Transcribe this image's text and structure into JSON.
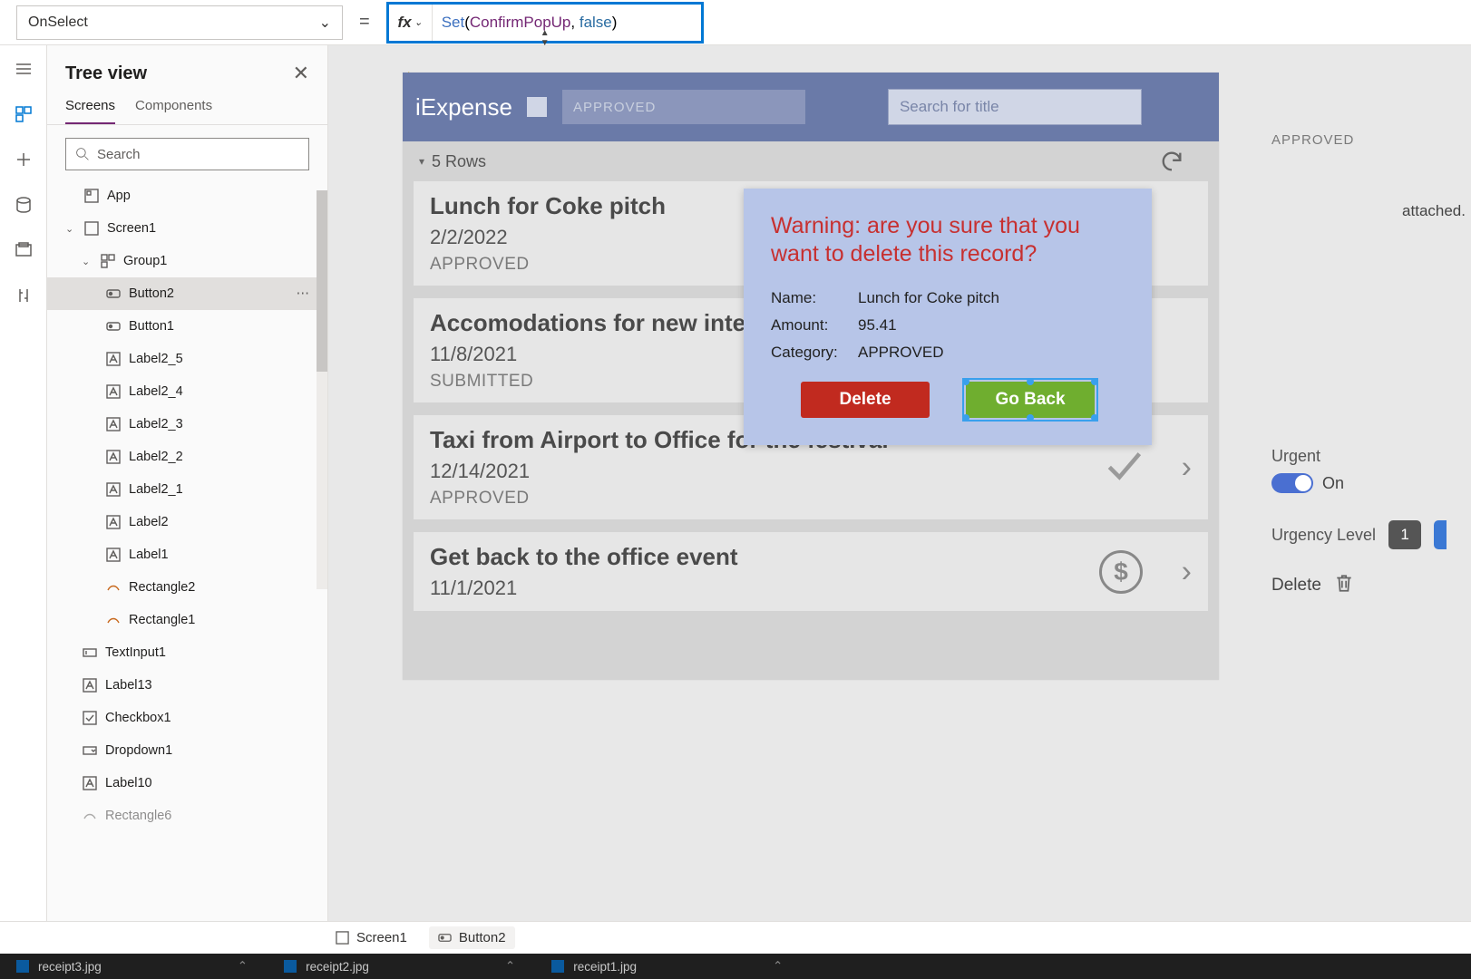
{
  "propertyDropdown": "OnSelect",
  "formula": {
    "fn": "Set",
    "open": "(",
    "arg1": "ConfirmPopUp",
    "comma": ", ",
    "arg2": "false",
    "close": ")"
  },
  "treeView": {
    "title": "Tree view",
    "tabs": {
      "screens": "Screens",
      "components": "Components"
    },
    "searchPlaceholder": "Search",
    "items": {
      "app": "App",
      "screen1": "Screen1",
      "group1": "Group1",
      "button2": "Button2",
      "button1": "Button1",
      "label2_5": "Label2_5",
      "label2_4": "Label2_4",
      "label2_3": "Label2_3",
      "label2_2": "Label2_2",
      "label2_1": "Label2_1",
      "label2": "Label2",
      "label1": "Label1",
      "rectangle2": "Rectangle2",
      "rectangle1": "Rectangle1",
      "textinput1": "TextInput1",
      "label13": "Label13",
      "checkbox1": "Checkbox1",
      "dropdown1": "Dropdown1",
      "label10": "Label10",
      "rectangle6": "Rectangle6"
    }
  },
  "app": {
    "title": "iExpense",
    "filterDropdown": "APPROVED",
    "searchPlaceholder": "Search for title",
    "rowsLabel": "5 Rows",
    "cards": [
      {
        "title": "Lunch for Coke pitch",
        "date": "2/2/2022",
        "status": "APPROVED",
        "icon": "check"
      },
      {
        "title": "Accomodations for new interv",
        "date": "11/8/2021",
        "status": "SUBMITTED",
        "icon": ""
      },
      {
        "title": "Taxi from Airport to Office for the festival",
        "date": "12/14/2021",
        "status": "APPROVED",
        "icon": "check"
      },
      {
        "title": "Get back to the office event",
        "date": "11/1/2021",
        "status": "",
        "icon": "dollar"
      }
    ]
  },
  "popup": {
    "warning": "Warning: are you sure that you want to delete this record?",
    "nameLabel": "Name:",
    "nameValue": "Lunch for Coke pitch",
    "amountLabel": "Amount:",
    "amountValue": "95.41",
    "categoryLabel": "Category:",
    "categoryValue": "APPROVED",
    "deleteBtn": "Delete",
    "goBackBtn": "Go Back"
  },
  "sidePanel": {
    "approved": "APPROVED",
    "attached": "attached.",
    "urgentLabel": "Urgent",
    "toggleText": "On",
    "urgencyLevelLabel": "Urgency Level",
    "urgencyValue": "1",
    "deleteLabel": "Delete"
  },
  "breadcrumb": {
    "screen1": "Screen1",
    "button2": "Button2"
  },
  "taskbar": {
    "f1": "receipt3.jpg",
    "f2": "receipt2.jpg",
    "f3": "receipt1.jpg"
  }
}
